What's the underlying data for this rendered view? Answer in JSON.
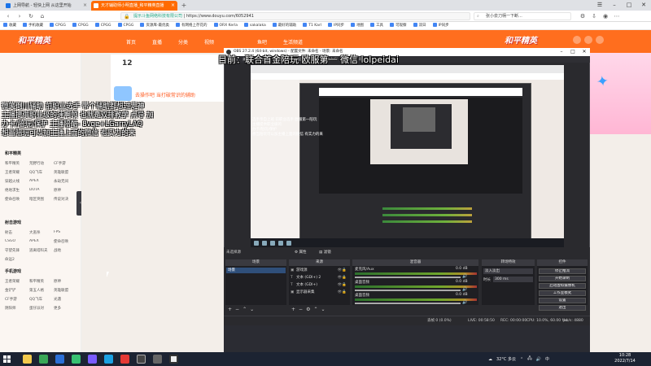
{
  "browser": {
    "tabs": [
      {
        "label": "上网导航 - 轻快上网 从这里开始"
      },
      {
        "label": "天才辅助师小明直播_和平精英直播"
      }
    ],
    "url": "https://www.douyu.com/6052941",
    "url_prefix": "提示斗鱼网络科技有限公司",
    "search_placeholder": "张小泉刀柄一下断",
    "search_suffix": "...",
    "bookmarks": [
      "收藏",
      "手机收藏",
      "CPGG",
      "CPGG",
      "CPGG",
      "CPGG",
      "资源库-最优类",
      "有网络上存花的",
      "ORX Kerla",
      "sakalaka",
      "最好的辅助",
      "T1 Karl",
      "IP同步",
      "地图",
      "工具",
      "可观察",
      "双日",
      "IP同步"
    ]
  },
  "site": {
    "logo": "和平精英",
    "logo_right": "和平精英",
    "nav": [
      "首页",
      "直播",
      "分类",
      "视频",
      "鱼吧",
      "生活频道"
    ],
    "follow_count": "12",
    "promo_text": "去操作吧 当打破常识的辅助"
  },
  "sidebar": {
    "section1": "和平精英",
    "items1": [
      "和平精英",
      "荒野行动",
      "CF手游",
      "王者荣耀",
      "QQ飞车",
      "英雄联盟",
      "穿越火线",
      "APEX",
      "永劫无间",
      "绝地求生",
      "DOTA",
      "原神",
      "使命召唤",
      "暗区突围",
      "传说对决"
    ],
    "section2": "射击游戏",
    "items2": [
      "射击",
      "大逃杀",
      "FPS",
      "CSGO",
      "APEX",
      "使命召唤",
      "守望先锋",
      "逃离塔科夫",
      "战地",
      "命运2"
    ],
    "section3": "手机游戏",
    "items3": [
      "王者荣耀",
      "和平精英",
      "原神",
      "金铲铲",
      "第五人格",
      "英雄联盟",
      "CF手游",
      "QQ飞车",
      "光遇",
      "阴阳师",
      "蛋仔派对",
      "更多"
    ]
  },
  "overlay": {
    "top": "目前：联合首金陪玩  欧服第一 微信 lolpeidai",
    "left_lines": [
      "微笑倒川辅助 前职业选手 带个辅助都想过走神",
      "主播提供职业级的速啊领 也就是双排教学 点导 加",
      "办卡/陪玩/保护 主播陪酷- 8vqe+LGarryLAQ",
      "想当陪玩可以加主播上面的微信 有实力的来"
    ]
  },
  "obs": {
    "title": "OBS 27.2.4 (64-bit, windows) - 配置文件: 未命名 - 场景: 未命名",
    "menu": [
      "文件(F)",
      "编辑(E)",
      "视图(V)",
      "停靠窗口(D)",
      "配置文件(P)",
      "场景集合(S)",
      "工具(T)",
      "帮助(H)"
    ],
    "preview_text": [
      "选手亲自上班 前职业选手 欧服第一陪玩",
      "主播提供职业级的",
      "办卡/陪玩/保护",
      "想当陪玩可以加主播上面的微信 有实力的来"
    ],
    "scene_info": "未选择源",
    "props_btn": "属性",
    "filter_btn": "滤镜",
    "panels": {
      "scenes": "场景",
      "sources": "来源",
      "mixer": "混音器",
      "transitions": "转场特效",
      "controls": "控件"
    },
    "scene_items": [
      "场景"
    ],
    "sources": [
      {
        "icon": "▣",
        "name": "游戏源"
      },
      {
        "icon": "T",
        "name": "文本 (GDI+) 2"
      },
      {
        "icon": "T",
        "name": "文本 (GDI+)"
      },
      {
        "icon": "▣",
        "name": "显示器采集"
      }
    ],
    "mixer": [
      {
        "name": "麦克风/Aux",
        "db": "0.0 dB"
      },
      {
        "name": "桌面音频",
        "db": "0.0 dB"
      },
      {
        "name": "桌面音频",
        "db": "0.0 dB"
      }
    ],
    "transition_selected": "淡入淡出",
    "duration_label": "时长",
    "duration_value": "300 ms",
    "controls": [
      "停止推流",
      "开始录制",
      "启动虚拟摄像机",
      "工作室模式",
      "设置",
      "退出"
    ],
    "status": {
      "drop": "丢帧 0 (0.0%)",
      "live": "LIVE: 00:58:50",
      "rec": "REC: 00:00:00",
      "cpu": "CPU: 10.0%, 60.00 fps",
      "kbps": "kb/s: 4880"
    }
  },
  "taskbar": {
    "weather": "32°C 多云",
    "time": "10:28",
    "date": "2022/7/14",
    "lang": "中"
  }
}
